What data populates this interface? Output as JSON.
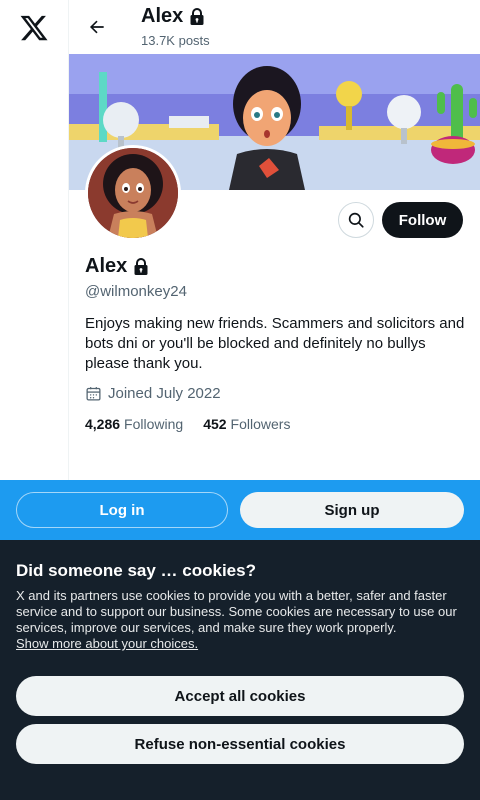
{
  "header": {
    "name": "Alex",
    "posts": "13.7K posts"
  },
  "profile": {
    "name": "Alex",
    "handle": "@wilmonkey24",
    "bio": "Enjoys making new friends. Scammers and solicitors and bots dni or you'll be blocked and definitely no bullys please thank you.",
    "joined": "Joined July 2022",
    "following_count": "4,286",
    "following_label": "Following",
    "followers_count": "452",
    "followers_label": "Followers"
  },
  "actions": {
    "follow_label": "Follow"
  },
  "auth_bar": {
    "login_label": "Log in",
    "signup_label": "Sign up",
    "color": "#1d9bf0"
  },
  "cookies": {
    "title": "Did someone say … cookies?",
    "text": "X and its partners use cookies to provide you with a better, safer and faster service and to support our business. Some cookies are necessary to use our services, improve our services, and make sure they work properly.",
    "link": "Show more about your choices.",
    "accept_label": "Accept all cookies",
    "refuse_label": "Refuse non-essential cookies"
  },
  "icons": [
    "x-logo-icon",
    "back-arrow-icon",
    "lock-icon",
    "search-icon",
    "calendar-icon"
  ]
}
